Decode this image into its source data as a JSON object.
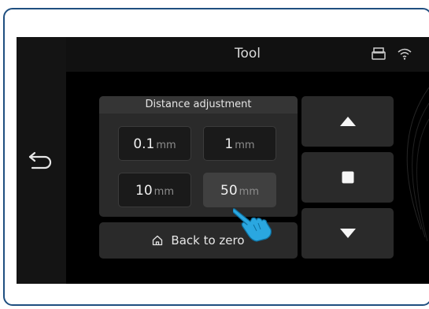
{
  "header": {
    "title": "Tool",
    "icons": [
      "printer-icon",
      "wifi-icon"
    ]
  },
  "sidebar": {
    "back_icon": "back-arrow-icon"
  },
  "distance": {
    "heading": "Distance adjustment",
    "selected": "50mm",
    "options": [
      {
        "value": "0.1",
        "unit": "mm"
      },
      {
        "value": "1",
        "unit": "mm"
      },
      {
        "value": "10",
        "unit": "mm"
      },
      {
        "value": "50",
        "unit": "mm"
      }
    ]
  },
  "zero_button": {
    "label": "Back to zero",
    "icon": "home-icon"
  },
  "controls": {
    "up_icon": "up-triangle-icon",
    "stop_icon": "stop-square-icon",
    "down_icon": "down-triangle-icon"
  },
  "colors": {
    "accent": "#1f4f80",
    "hand": "#2aa7e0"
  }
}
